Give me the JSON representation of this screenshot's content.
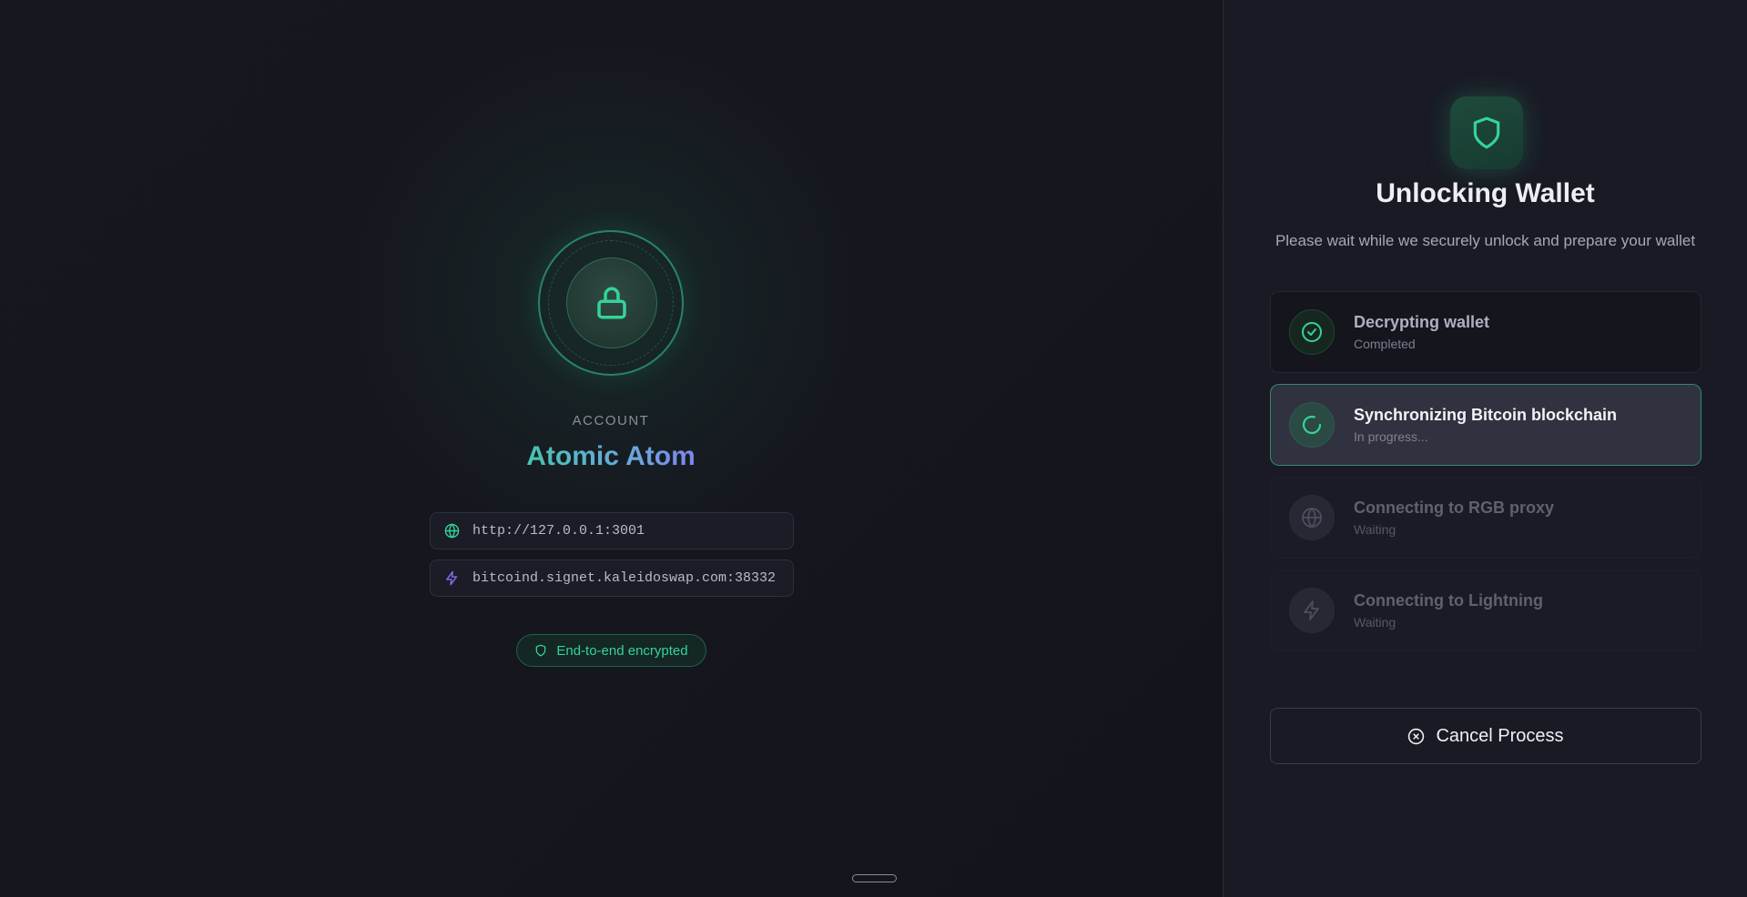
{
  "account": {
    "label": "ACCOUNT",
    "name": "Atomic Atom",
    "endpoints": [
      {
        "icon": "globe-icon",
        "value": "http://127.0.0.1:3001"
      },
      {
        "icon": "lightning-icon",
        "value": "bitcoind.signet.kaleidoswap.com:38332"
      }
    ],
    "badge": "End-to-end encrypted"
  },
  "unlock": {
    "title": "Unlocking Wallet",
    "subtitle": "Please wait while we securely unlock and prepare your wallet",
    "steps": [
      {
        "title": "Decrypting wallet",
        "status": "Completed",
        "state": "completed",
        "icon": "check-circle-icon"
      },
      {
        "title": "Synchronizing Bitcoin blockchain",
        "status": "In progress...",
        "state": "active",
        "icon": "spinner-icon"
      },
      {
        "title": "Connecting to RGB proxy",
        "status": "Waiting",
        "state": "waiting",
        "icon": "globe-icon"
      },
      {
        "title": "Connecting to Lightning",
        "status": "Waiting",
        "state": "waiting",
        "icon": "lightning-icon"
      }
    ],
    "cancel_label": "Cancel Process"
  },
  "colors": {
    "accent": "#34d399",
    "purple": "#8b6cf0",
    "background": "#15161f"
  }
}
